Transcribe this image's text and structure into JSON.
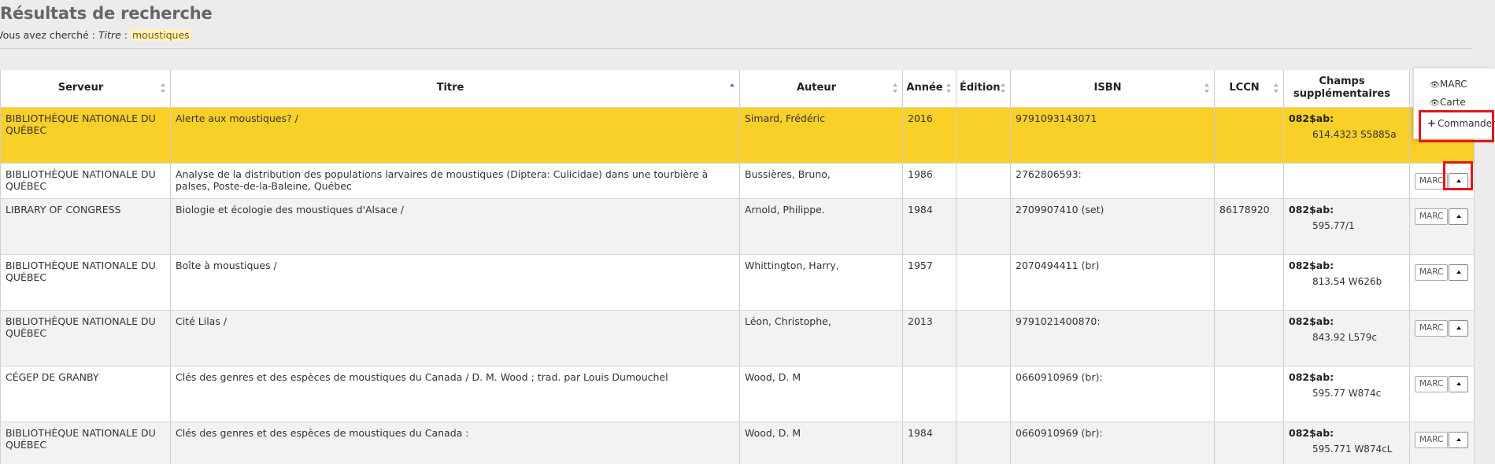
{
  "page": {
    "title": "Résultats de recherche",
    "searched_prefix": "Vous avez cherché :",
    "searched_field": "Titre",
    "searched_sep": ":",
    "searched_term": "moustiques"
  },
  "table": {
    "headers": {
      "server": "Serveur",
      "title": "Titre",
      "author": "Auteur",
      "year": "Année",
      "edition": "Édition",
      "isbn": "ISBN",
      "lccn": "LCCN",
      "extra": "Champs supplémentaires"
    },
    "rows": [
      {
        "server": "BIBLIOTHÈQUE NATIONALE DU QUÉBEC",
        "title": "Alerte aux moustiques? /",
        "author": "Simard, Frédéric",
        "year": "2016",
        "edition": "",
        "isbn": "9791093143071",
        "lccn": "",
        "extra_label": "082$ab:",
        "extra_value": "614.4323 S5885a"
      },
      {
        "server": "BIBLIOTHÈQUE NATIONALE DU QUÉBEC",
        "title": "Analyse de la distribution des populations larvaires de moustiques (Diptera: Culicidae) dans une tourbière à palses, Poste-de-la-Baleine, Québec",
        "author": "Bussières, Bruno,",
        "year": "1986",
        "edition": "",
        "isbn": "2762806593:",
        "lccn": "",
        "extra_label": "",
        "extra_value": ""
      },
      {
        "server": "LIBRARY OF CONGRESS",
        "title": "Biologie et écologie des moustiques d'Alsace /",
        "author": "Arnold, Philippe.",
        "year": "1984",
        "edition": "",
        "isbn": "2709907410 (set)",
        "lccn": "86178920",
        "extra_label": "082$ab:",
        "extra_value": "595.77/1"
      },
      {
        "server": "BIBLIOTHÈQUE NATIONALE DU QUÉBEC",
        "title": "Boîte à moustiques /",
        "author": "Whittington, Harry,",
        "year": "1957",
        "edition": "",
        "isbn": "2070494411 (br)",
        "lccn": "",
        "extra_label": "082$ab:",
        "extra_value": "813.54 W626b"
      },
      {
        "server": "BIBLIOTHÈQUE NATIONALE DU QUÉBEC",
        "title": "Cité Lilas /",
        "author": "Léon, Christophe,",
        "year": "2013",
        "edition": "",
        "isbn": "9791021400870:",
        "lccn": "",
        "extra_label": "082$ab:",
        "extra_value": "843.92 L579c"
      },
      {
        "server": "CÉGEP DE GRANBY",
        "title": "Clés des genres et des espèces de moustiques du Canada / D. M. Wood ; trad. par Louis Dumouchel",
        "author": "Wood, D. M",
        "year": "",
        "edition": "",
        "isbn": "0660910969 (br):",
        "lccn": "",
        "extra_label": "082$ab:",
        "extra_value": "595.77 W874c"
      },
      {
        "server": "BIBLIOTHÈQUE NATIONALE DU QUÉBEC",
        "title": "Clés des genres et des espèces de moustiques du Canada :",
        "author": "Wood, D. M",
        "year": "1984",
        "edition": "",
        "isbn": "0660910969 (br):",
        "lccn": "",
        "extra_label": "082$ab:",
        "extra_value": "595.771 W874cL"
      }
    ],
    "marc_button": "MARC"
  },
  "dropdown": {
    "marc": "MARC",
    "card": "Carte",
    "order": "Commander"
  }
}
